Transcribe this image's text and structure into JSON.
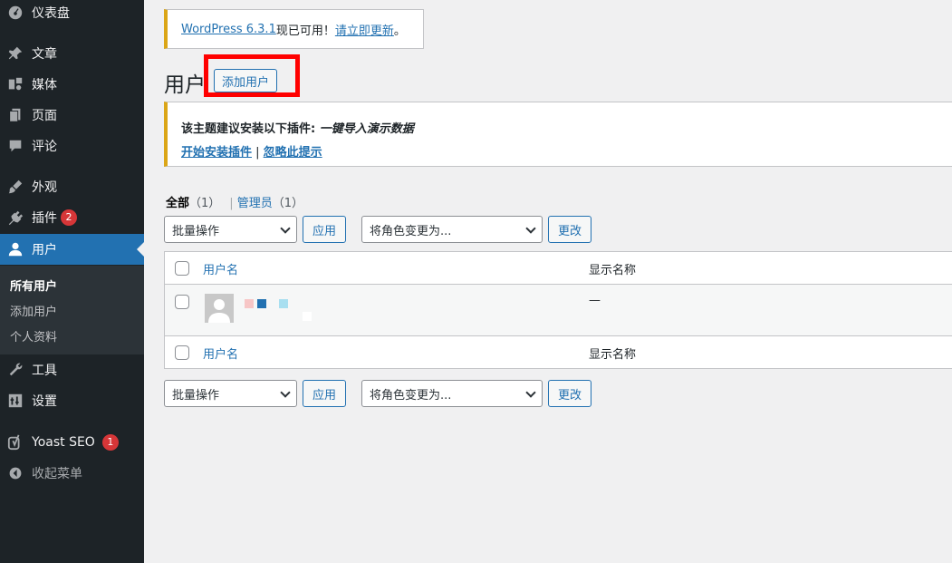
{
  "sidebar": {
    "dashboard": "仪表盘",
    "posts": "文章",
    "media": "媒体",
    "pages": "页面",
    "comments": "评论",
    "appearance": "外观",
    "plugins": "插件",
    "plugins_badge": "2",
    "users": "用户",
    "submenu": {
      "all_users": "所有用户",
      "add_user": "添加用户",
      "profile": "个人资料"
    },
    "tools": "工具",
    "settings": "设置",
    "yoast": "Yoast SEO",
    "yoast_badge": "1",
    "collapse": "收起菜单"
  },
  "update_notice": {
    "link": "WordPress 6.3.1",
    "text": "现已可用！",
    "action": "请立即更新",
    "period": "。"
  },
  "page": {
    "title": "用户",
    "add_button": "添加用户"
  },
  "plugin_notice": {
    "text": "该主题建议安装以下插件: ",
    "plugin": "一键导入演示数据",
    "install": "开始安装插件",
    "sep": " | ",
    "dismiss": "忽略此提示"
  },
  "filters": {
    "all": "全部",
    "all_count": "（1）",
    "sep": "|",
    "admin": "管理员",
    "admin_count": "（1）"
  },
  "actions": {
    "bulk": "批量操作",
    "apply": "应用",
    "role": "将角色变更为...",
    "change": "更改"
  },
  "table": {
    "col_username": "用户名",
    "col_display": "显示名称",
    "row_display": "—"
  },
  "colors": {
    "accent": "#2271b1",
    "sidebar_bg": "#1d2327",
    "highlight": "#ff0000",
    "warning": "#dba617"
  }
}
